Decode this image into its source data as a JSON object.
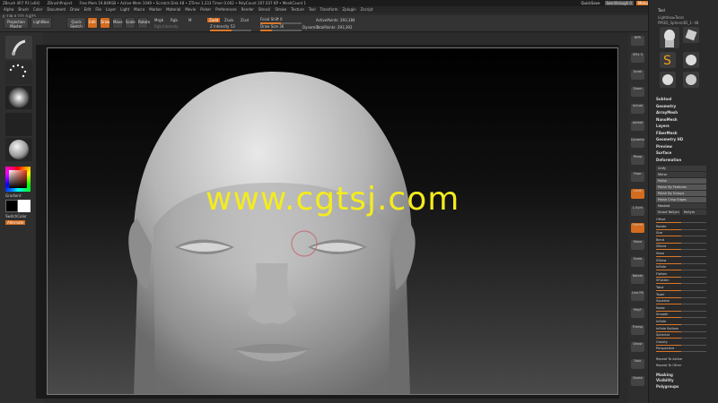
{
  "window": {
    "title": "ZBrush 4R7 P3 (x64)",
    "project": "ZBrushProject",
    "stats": "Free Mem 19.849GB • Active Mem 1049 • Scratch Disk 48 • ZTime 1.233 Timer 0.002 • PolyCount 207.037 KP • MeshCount 1",
    "quicksave": "QuickSave",
    "see_through": "See-through 0",
    "menus_btn": "Menus",
    "default_script": "DefaultZScript"
  },
  "menubar": [
    "Alpha",
    "Brush",
    "Color",
    "Document",
    "Draw",
    "Edit",
    "File",
    "Layer",
    "Light",
    "Macro",
    "Marker",
    "Material",
    "Movie",
    "Picker",
    "Preferences",
    "Render",
    "Stencil",
    "Stroke",
    "Texture",
    "Tool",
    "Transform",
    "Zplugin",
    "Zscript"
  ],
  "coord_readout": "0.238,0.271,0.875",
  "toolbar": {
    "projection_master": "Projection Master",
    "lightbox": "LightBox",
    "quick_sketch": "Quick Sketch",
    "edit": "Edit",
    "draw": "Draw",
    "move": "Move",
    "scale": "Scale",
    "rotate": "Rotate",
    "mrgb": "Mrgb",
    "rgb": "Rgb",
    "m": "M",
    "zadd": "Zadd",
    "zsub": "Zsub",
    "zcut": "Zcut",
    "rgb_intensity": "Rgb Intensity",
    "z_intensity": "Z Intensity 53",
    "focal_shift": "Focal Shift 0",
    "draw_size": "Draw Size 36",
    "dynamic": "Dynamic",
    "active_points": "ActivePoints: 293,184",
    "total_points": "TotalPoints: 293,392"
  },
  "left_shelf": {
    "gradient_label": "Gradient",
    "switch_color": "SwitchColor",
    "alternate": "Alternate"
  },
  "right_shelf": [
    "BPR",
    "SPix 3",
    "Scroll",
    "Zoom",
    "Actual",
    "AAHalf",
    "Dynamic",
    "Persp",
    "Floor",
    "Local",
    "L.Sym",
    "Frame",
    "Move",
    "Scale",
    "Rotate",
    "Line Fill",
    "PolyF",
    "Transp",
    "Ghost",
    "Solo",
    "Xpose"
  ],
  "tray": {
    "header": "Tool",
    "load_tool": "Load Tool",
    "save_as": "Save As",
    "import": "Import",
    "export": "Export",
    "lightbox_tools": "Lightbox▸Tools",
    "current_tool": "PM3D_Sphere3D_1: 48",
    "tool_names": [
      "SimpleBrush",
      "Sphere3D_1",
      "PM3D_Sphere3D_1"
    ],
    "sections": [
      "Subtool",
      "Geometry",
      "ArrayMesh",
      "NanoMesh",
      "Layers",
      "FiberMesh",
      "Geometry HD",
      "Preview",
      "Surface",
      "Deformation"
    ],
    "deform_rows": [
      "Unify",
      "Mirror",
      "Polish",
      "Polish By Features",
      "Polish By Groups",
      "Polish Crisp Edges",
      "Masked"
    ],
    "deform_sub": [
      "Smart ReSym",
      "ReSym"
    ],
    "sliders": [
      {
        "label": "Offset",
        "level": 0.5
      },
      {
        "label": "Rotate",
        "level": 0.5
      },
      {
        "label": "Size",
        "level": 0.5
      },
      {
        "label": "Bend",
        "level": 0.5
      },
      {
        "label": "SBend",
        "level": 0.5
      },
      {
        "label": "Skew",
        "level": 0.5
      },
      {
        "label": "SSkew",
        "level": 0.5
      },
      {
        "label": "Inflate",
        "level": 0.5
      },
      {
        "label": "Flatten",
        "level": 0.5
      },
      {
        "label": "SFlatten",
        "level": 0.5
      },
      {
        "label": "Twist",
        "level": 0.5
      },
      {
        "label": "Taper",
        "level": 0.5
      },
      {
        "label": "Squeeze",
        "level": 0.5
      },
      {
        "label": "Noise",
        "level": 0.5
      },
      {
        "label": "Smooth",
        "level": 0.5
      },
      {
        "label": "Inflate",
        "level": 0.5
      },
      {
        "label": "Inflate Balloon",
        "level": 0.5
      },
      {
        "label": "Spherize",
        "level": 0.5
      },
      {
        "label": "Gravity",
        "level": 0.5
      },
      {
        "label": "Perspective",
        "level": 0.5
      }
    ],
    "bottom_items": [
      "Repeat To Active",
      "Repeat To Other",
      "Masking",
      "Visibility",
      "Polygroups"
    ]
  },
  "watermark": "www.cgtsj.com"
}
